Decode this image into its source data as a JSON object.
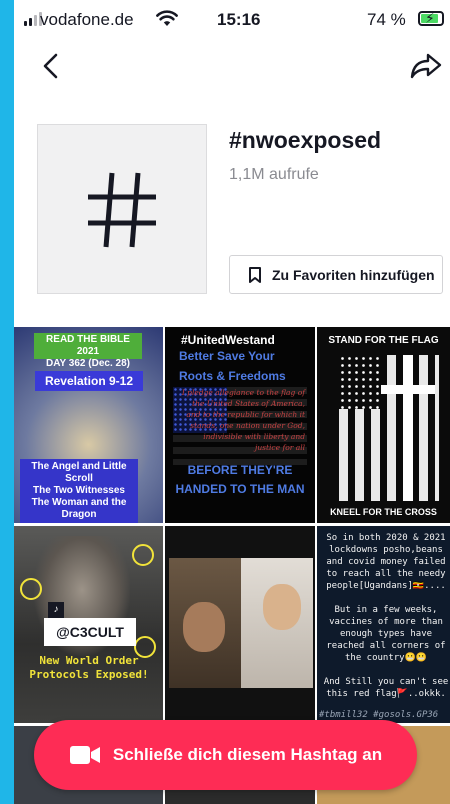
{
  "status_bar": {
    "carrier": "vodafone.de",
    "time": "15:16",
    "battery_percent": "74 %"
  },
  "hashtag": {
    "name": "#nwoexposed",
    "views": "1,1M aufrufe",
    "favorite_label": "Zu Favoriten hinzufügen"
  },
  "videos": [
    {
      "banner": "READ THE BIBLE 2021\nDAY 362 (Dec. 28)",
      "title": "Revelation 9-12",
      "caption": "The Angel and Little Scroll\nThe Two Witnesses\nThe Woman and the Dragon"
    },
    {
      "hashtag": "#UnitedWestand",
      "line1": "Better Save Your",
      "line2": "Roots & Freedoms",
      "pledge": "I pledge allegiance to the flag of the United States of America, and to the republic for which it stands, one nation under God, indivisible with liberty and justice for all",
      "bottom": "BEFORE THEY'RE HANDED TO THE MAN"
    },
    {
      "top": "STAND FOR THE FLAG",
      "bottom": "KNEEL FOR THE CROSS"
    },
    {
      "handle": "@C3CULT",
      "caption": "New World Order\nProtocols Exposed!"
    },
    {
      "note": ""
    },
    {
      "text": "So in both 2020 & 2021\nlockdowns posho,beans\nand covid money failed\nto reach all the needy\npeople[Ugandans]🇺🇬....\n\nBut in a few weeks,\nvaccines of more than\nenough types have\nreached all corners of\nthe country😬😬\n\nAnd Still you can't see\nthis red flag🚩..okkk.",
      "tags": "#tbmill32 #gosols.GP36"
    }
  ],
  "join_button": {
    "label": "Schließe dich diesem Hashtag an"
  },
  "colors": {
    "accent": "#fe2c55",
    "frame": "#1fb6e8"
  }
}
